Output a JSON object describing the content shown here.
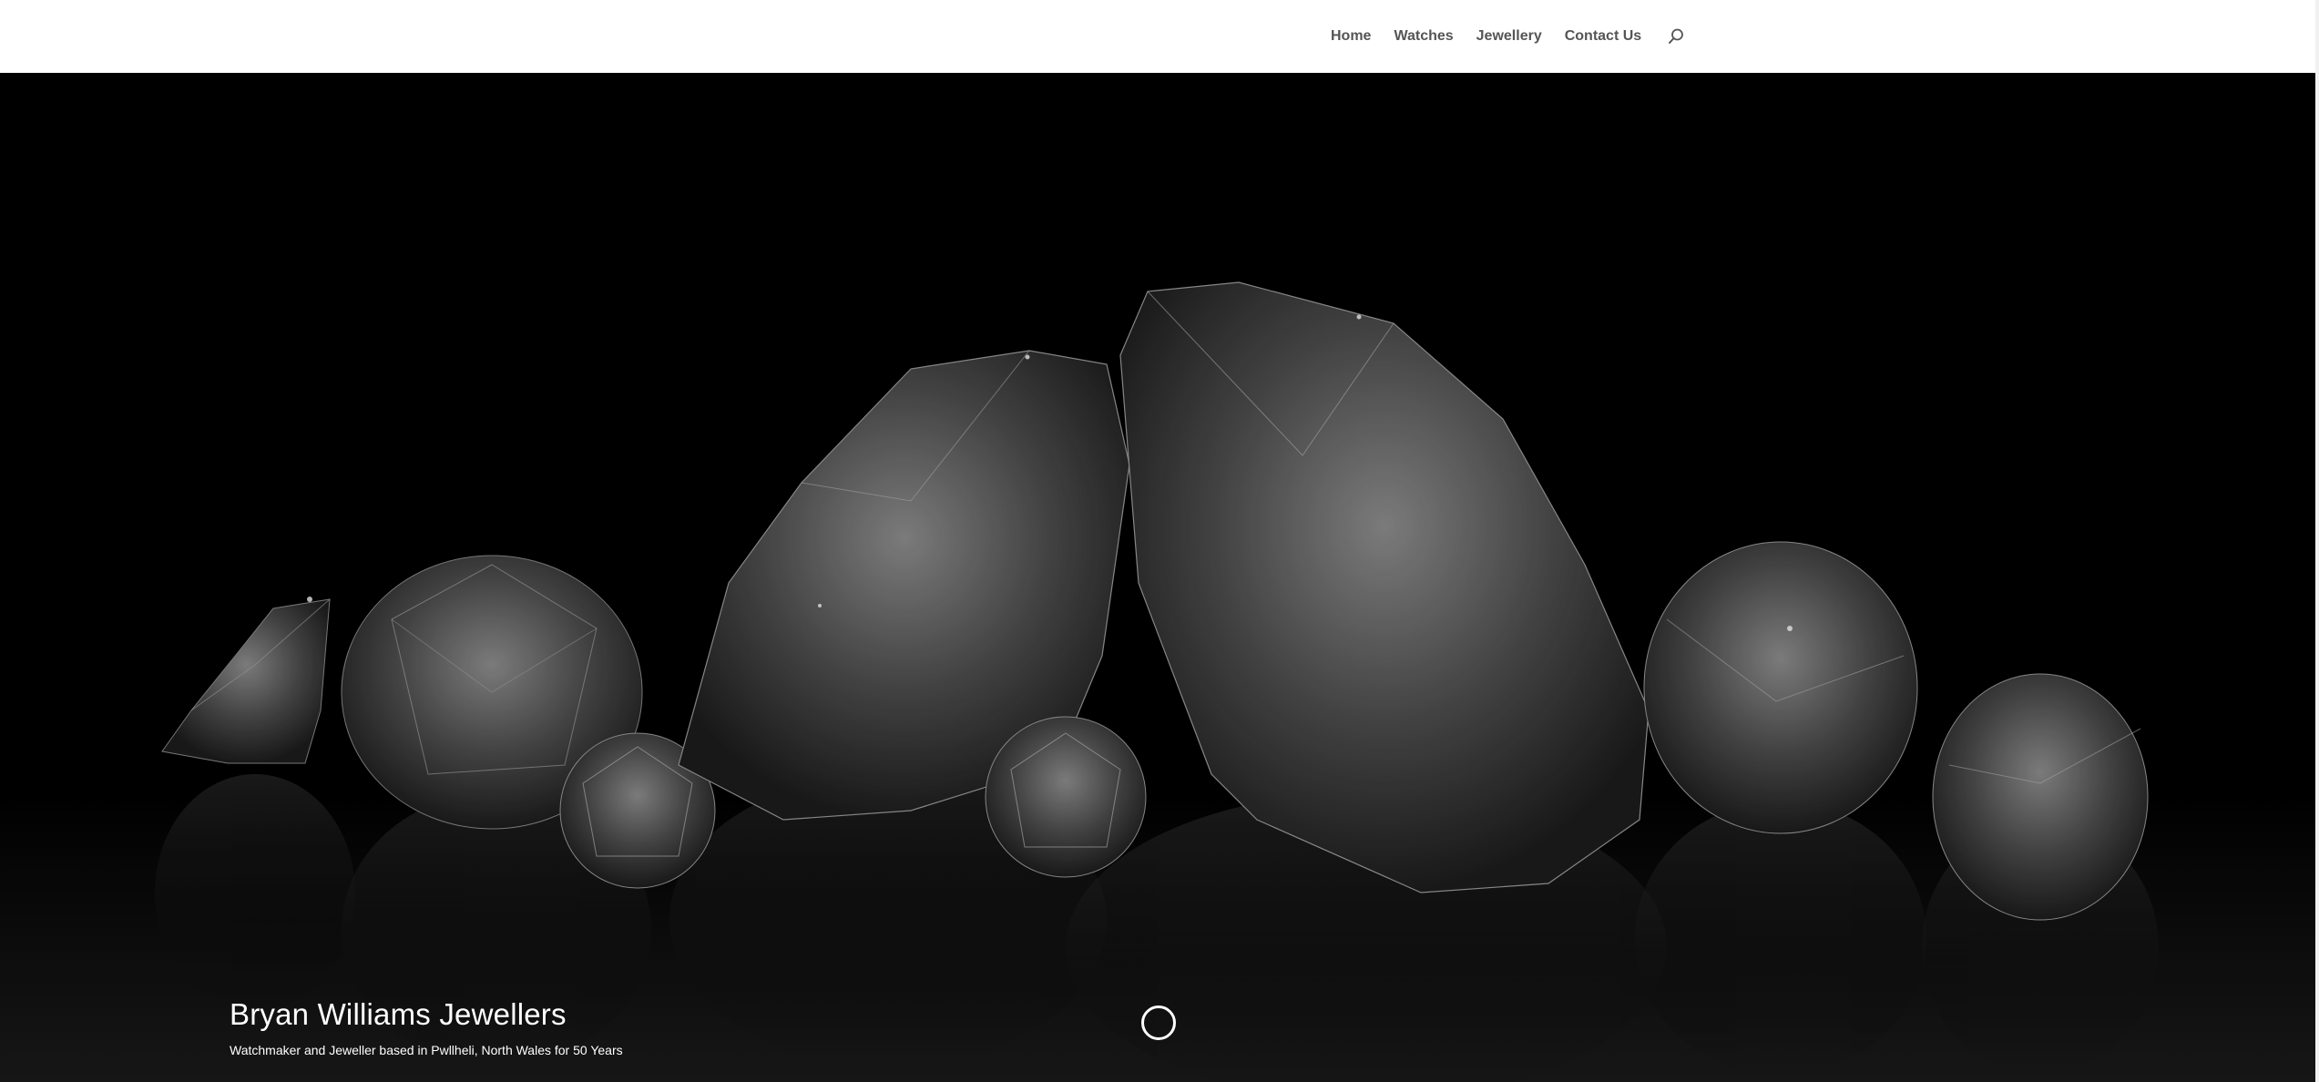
{
  "nav": {
    "items": [
      {
        "label": "Home"
      },
      {
        "label": "Watches"
      },
      {
        "label": "Jewellery"
      },
      {
        "label": "Contact Us"
      }
    ],
    "search_icon": "search-icon"
  },
  "hero": {
    "title": "Bryan Williams Jewellers",
    "subtitle": "Watchmaker and Jeweller based in Pwllheli, North Wales for 50 Years",
    "background": "black backdrop with diamonds",
    "scroll_icon": "scroll-down-icon"
  },
  "colors": {
    "header_bg": "#ffffff",
    "nav_text": "#555555",
    "hero_bg": "#000000",
    "hero_text": "#ffffff"
  }
}
